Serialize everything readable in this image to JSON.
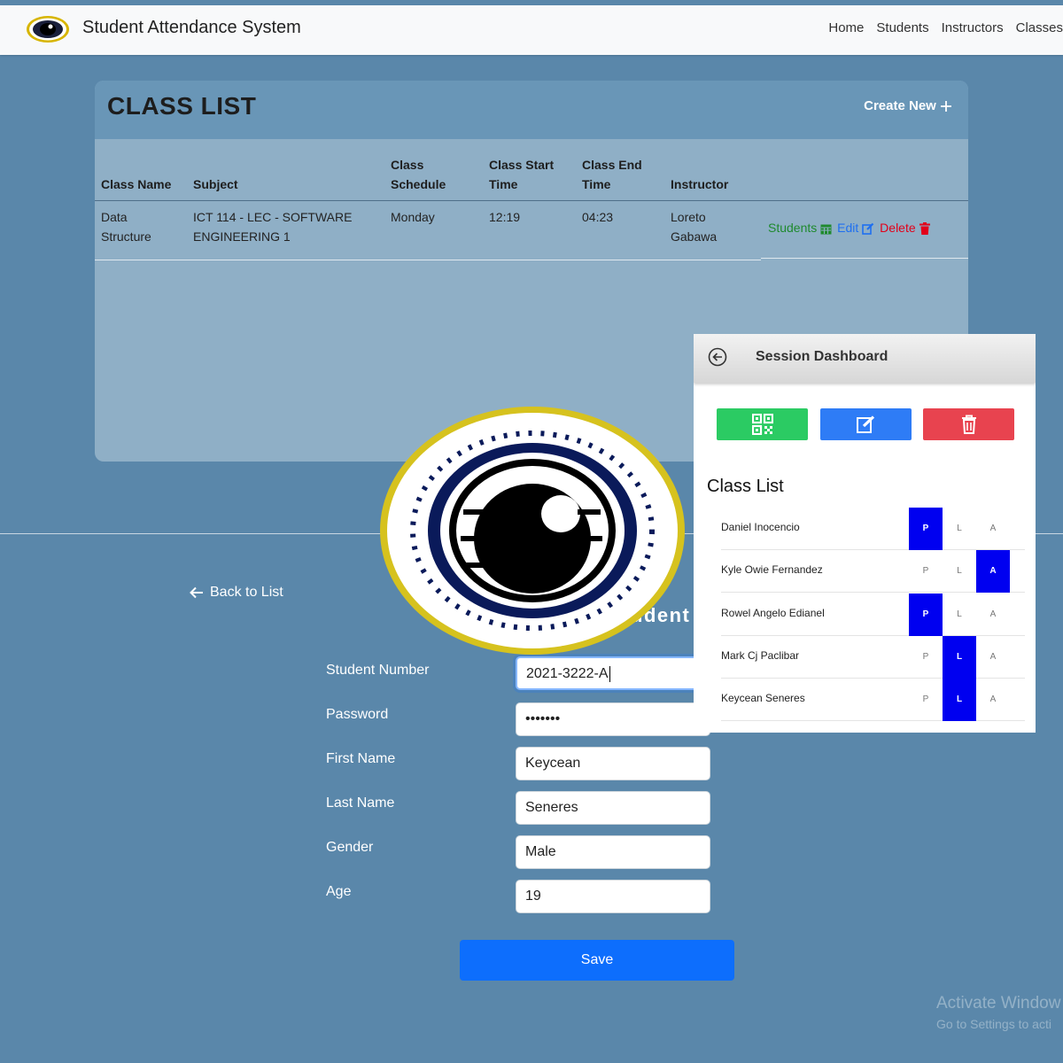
{
  "navbar": {
    "brand": "Student Attendance System",
    "links": [
      "Home",
      "Students",
      "Instructors",
      "Classes"
    ]
  },
  "class_list": {
    "title": "CLASS LIST",
    "create_new": "Create New",
    "headers": {
      "class_name": "Class Name",
      "subject": "Subject",
      "class_schedule_1": "Class",
      "class_schedule_2": "Schedule",
      "start_1": "Class Start",
      "start_2": "Time",
      "end_1": "Class End",
      "end_2": "Time",
      "instructor": "Instructor"
    },
    "row": {
      "class_name_1": "Data",
      "class_name_2": "Structure",
      "subject_1": "ICT 114 - LEC - SOFTWARE",
      "subject_2": "ENGINEERING 1",
      "schedule": "Monday",
      "start": "12:19",
      "end": "04:23",
      "instructor_1": "Loreto",
      "instructor_2": "Gabawa",
      "actions": {
        "students": "Students",
        "edit": "Edit",
        "delete": "Delete"
      }
    }
  },
  "form": {
    "back": "Back to List",
    "heading_fragment": "udent",
    "fields": {
      "student_number": {
        "label": "Student Number",
        "value": "2021-3222-A"
      },
      "password": {
        "label": "Password",
        "value": "•••••••"
      },
      "first_name": {
        "label": "First Name",
        "value": "Keycean"
      },
      "last_name": {
        "label": "Last Name",
        "value": "Seneres"
      },
      "gender": {
        "label": "Gender",
        "value": "Male"
      },
      "age": {
        "label": "Age",
        "value": "19"
      }
    },
    "save": "Save"
  },
  "watermark": {
    "line1": "Activate Window",
    "line2": "Go to Settings to acti"
  },
  "session_dashboard": {
    "title": "Session Dashboard",
    "buttons": [
      "qr-code-icon",
      "edit-icon",
      "trash-icon"
    ],
    "list_title": "Class List",
    "status_labels": {
      "p": "P",
      "l": "L",
      "a": "A"
    },
    "students": [
      {
        "name": "Daniel Inocencio",
        "status": "P"
      },
      {
        "name": "Kyle Owie Fernandez",
        "status": "A"
      },
      {
        "name": "Rowel Angelo Edianel",
        "status": "P"
      },
      {
        "name": "Mark Cj Paclibar",
        "status": "L"
      },
      {
        "name": "Keycean Seneres",
        "status": "L"
      }
    ]
  },
  "colors": {
    "page_bg": "#5a87aa",
    "card_bg": "#8fafc6",
    "card_header": "#6996b7",
    "save_button": "#0d6efd",
    "present_highlight": "#0000f0"
  }
}
